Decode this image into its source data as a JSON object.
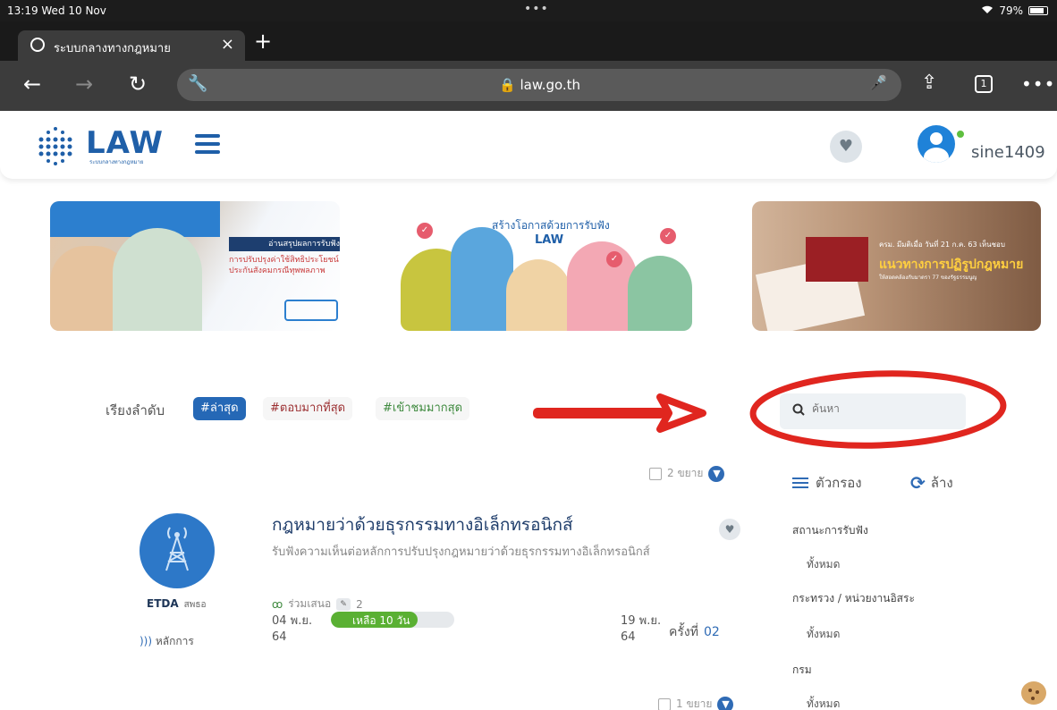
{
  "status_bar": {
    "time_date": "13:19  Wed 10 Nov",
    "battery": "79%"
  },
  "browser": {
    "tab_title": "ระบบกลางทางกฎหมาย",
    "tab_close": "×",
    "new_tab": "+",
    "url": "law.go.th",
    "tab_count": "1",
    "more": "•••"
  },
  "header": {
    "logo": "LAW",
    "logo_subtitle": "ระบบกลางทางกฎหมาย",
    "username": "sine1409"
  },
  "banners": [
    {
      "heading": "อ่านสรุปผลการรับฟัง",
      "text": "การปรับปรุงค่าใช้สิทธิประโยชน์ กองทุนประกันสังคมกรณีทุพพลภาพ"
    },
    {
      "heading": "สร้างโอกาสด้วยการรับฟัง",
      "logo": "LAW"
    },
    {
      "meta": "ครม. มีมติเมื่อ วันที่ 21 ก.ค. 63 เห็นชอบ",
      "heading": "แนวทางการปฏิรูปกฎหมาย",
      "sub": "ให้สอดคล้องกับมาตรา 77 ของรัฐธรรมนูญ"
    }
  ],
  "sort": {
    "label": "เรียงลำดับ",
    "options": [
      "#ล่าสุด",
      "#ตอบมากที่สุด",
      "#เข้าชมมากสุด"
    ],
    "active_index": 0
  },
  "search": {
    "placeholder": "ค้นหา"
  },
  "filters": {
    "filter_label": "ตัวกรอง",
    "clear_label": "ล้าง",
    "groups": [
      {
        "title": "สถานะการรับฟัง",
        "value": "ทั้งหมด"
      },
      {
        "title": "กระทรวง / หน่วยงานอิสระ",
        "value": "ทั้งหมด"
      },
      {
        "title": "กรม",
        "value": "ทั้งหมด"
      }
    ]
  },
  "list": {
    "item": {
      "expand_label": "2 ขยาย",
      "title": "กฎหมายว่าด้วยธุรกรรมทางอิเล็กทรอนิกส์",
      "description": "รับฟังความเห็นต่อหลักการปรับปรุงกฎหมายว่าด้วยธุรกรรมทางอิเล็กทรอนิกส์",
      "agency_code": "ETDA",
      "agency_name": "สพธอ",
      "type_label": "หลักการ",
      "participant_label": "ร่วมเสนอ",
      "comments": "2",
      "start_date_line1": "04 พ.ย.",
      "start_date_line2": "64",
      "remaining": "เหลือ 10 วัน",
      "remaining_fraction": 0.7,
      "end_date_line1": "19 พ.ย.",
      "end_date_line2": "64",
      "round_label": "ครั้งที่",
      "round_number": "02"
    },
    "next_expand_label": "1 ขยาย"
  },
  "colors": {
    "brand_blue": "#1f5fa8",
    "annotation_red": "#e0261f",
    "remaining_green": "#5ab033"
  }
}
